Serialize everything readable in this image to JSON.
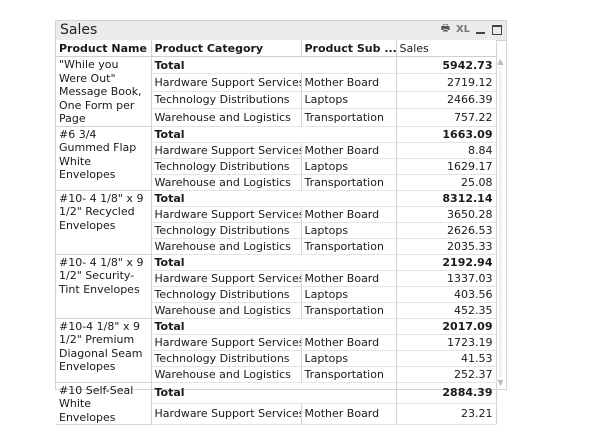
{
  "window": {
    "title": "Sales",
    "xl_label": "XL"
  },
  "columns": {
    "name": "Product Name",
    "category": "Product Category",
    "sub": "Product Sub ...",
    "sales": "Sales"
  },
  "groups": [
    {
      "name": "\"While you Were Out\" Message Book, One Form per Page",
      "total_label": "Total",
      "total": "5942.73",
      "rows": [
        {
          "category": "Hardware Support Services",
          "sub": "Mother Board",
          "sales": "2719.12"
        },
        {
          "category": "Technology Distributions",
          "sub": "Laptops",
          "sales": "2466.39"
        },
        {
          "category": "Warehouse and Logistics",
          "sub": "Transportation",
          "sales": "757.22"
        }
      ]
    },
    {
      "name": "#6 3/4 Gummed Flap White Envelopes",
      "total_label": "Total",
      "total": "1663.09",
      "rows": [
        {
          "category": "Hardware Support Services",
          "sub": "Mother Board",
          "sales": "8.84"
        },
        {
          "category": "Technology Distributions",
          "sub": "Laptops",
          "sales": "1629.17"
        },
        {
          "category": "Warehouse and Logistics",
          "sub": "Transportation",
          "sales": "25.08"
        }
      ]
    },
    {
      "name": "#10- 4 1/8\" x 9 1/2\" Recycled Envelopes",
      "total_label": "Total",
      "total": "8312.14",
      "rows": [
        {
          "category": "Hardware Support Services",
          "sub": "Mother Board",
          "sales": "3650.28"
        },
        {
          "category": "Technology Distributions",
          "sub": "Laptops",
          "sales": "2626.53"
        },
        {
          "category": "Warehouse and Logistics",
          "sub": "Transportation",
          "sales": "2035.33"
        }
      ]
    },
    {
      "name": "#10- 4 1/8\" x 9 1/2\" Security-Tint Envelopes",
      "total_label": "Total",
      "total": "2192.94",
      "rows": [
        {
          "category": "Hardware Support Services",
          "sub": "Mother Board",
          "sales": "1337.03"
        },
        {
          "category": "Technology Distributions",
          "sub": "Laptops",
          "sales": "403.56"
        },
        {
          "category": "Warehouse and Logistics",
          "sub": "Transportation",
          "sales": "452.35"
        }
      ]
    },
    {
      "name": "#10-4 1/8\" x 9 1/2\" Premium Diagonal Seam Envelopes",
      "total_label": "Total",
      "total": "2017.09",
      "rows": [
        {
          "category": "Hardware Support Services",
          "sub": "Mother Board",
          "sales": "1723.19"
        },
        {
          "category": "Technology Distributions",
          "sub": "Laptops",
          "sales": "41.53"
        },
        {
          "category": "Warehouse and Logistics",
          "sub": "Transportation",
          "sales": "252.37"
        }
      ]
    },
    {
      "name": "#10 Self-Seal White Envelopes",
      "total_label": "Total",
      "total": "2884.39",
      "rows": [
        {
          "category": "Hardware Support Services",
          "sub": "Mother Board",
          "sales": "23.21"
        }
      ]
    }
  ]
}
